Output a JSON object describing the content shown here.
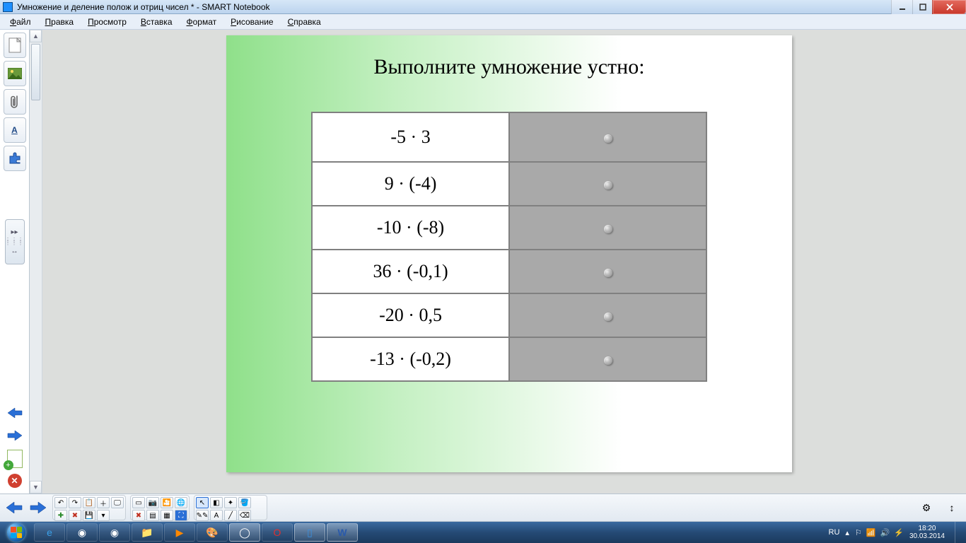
{
  "window": {
    "title": "Умножение и деление полож и отриц чисел * - SMART Notebook"
  },
  "menu": {
    "items": [
      "Файл",
      "Правка",
      "Просмотр",
      "Вставка",
      "Формат",
      "Рисование",
      "Справка"
    ]
  },
  "side_tabs": {
    "page_icon": "page-icon",
    "image_icon": "image-icon",
    "attach_icon": "paperclip-icon",
    "text_icon": "text-style-icon",
    "puzzle_icon": "puzzle-icon",
    "expand_icon": "expand-icon"
  },
  "slide": {
    "title": "Выполните умножение устно:",
    "rows": [
      {
        "expr": "-5 · 3"
      },
      {
        "expr": "9 · (-4)"
      },
      {
        "expr": "-10 · (-8)"
      },
      {
        "expr": "36 · (-0,1)"
      },
      {
        "expr": "-20 · 0,5"
      },
      {
        "expr": "-13 · (-0,2)"
      }
    ]
  },
  "toolbar": {
    "prev": "Назад",
    "next": "Вперёд",
    "undo": "↶",
    "redo": "↷",
    "paste": "📋",
    "new": "□",
    "open": "📂",
    "delete": "✕",
    "gear": "⚙",
    "updown": "↕"
  },
  "taskbar": {
    "lang": "RU",
    "time": "18:20",
    "date": "30.03.2014"
  }
}
